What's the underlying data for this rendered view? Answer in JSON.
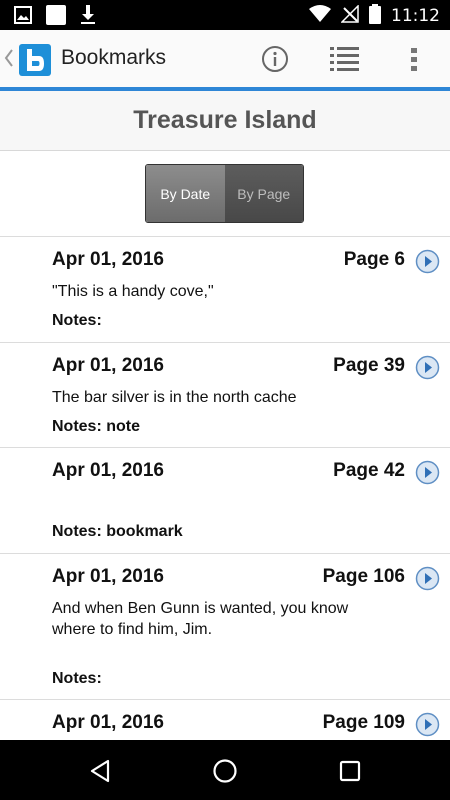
{
  "status_bar": {
    "time": "11:12",
    "icons": [
      "image-notification-icon",
      "blank-notification-icon",
      "download-icon",
      "wifi-icon",
      "no-signal-icon",
      "battery-icon"
    ]
  },
  "app_bar": {
    "title": "Bookmarks",
    "actions": [
      "info-icon",
      "list-icon",
      "more-vert-icon"
    ],
    "accent_color": "#2e86d6",
    "logo_color": "#1e8fd8"
  },
  "book": {
    "title": "Treasure Island"
  },
  "sort_toggle": {
    "by_date": "By Date",
    "by_page": "By Page",
    "selected": "By Date"
  },
  "bookmarks": [
    {
      "date": "Apr 01, 2016",
      "page": "Page 6",
      "quote": "\"This is a handy cove,\"",
      "notes_label": "Notes:",
      "notes": ""
    },
    {
      "date": "Apr 01, 2016",
      "page": "Page 39",
      "quote": "The bar silver is in the north cache",
      "notes_label": "Notes:",
      "notes": "note"
    },
    {
      "date": "Apr 01, 2016",
      "page": "Page 42",
      "quote": "",
      "notes_label": "Notes:",
      "notes": "bookmark"
    },
    {
      "date": "Apr 01, 2016",
      "page": "Page 106",
      "quote": "And when Ben Gunn is wanted, you know where to find him, Jim.",
      "notes_label": "Notes:",
      "notes": ""
    },
    {
      "date": "Apr 01, 2016",
      "page": "Page 109",
      "quote": "",
      "notes_label": "",
      "notes": ""
    }
  ],
  "nav_bar": {
    "buttons": [
      "back-icon",
      "home-icon",
      "recents-icon"
    ]
  }
}
